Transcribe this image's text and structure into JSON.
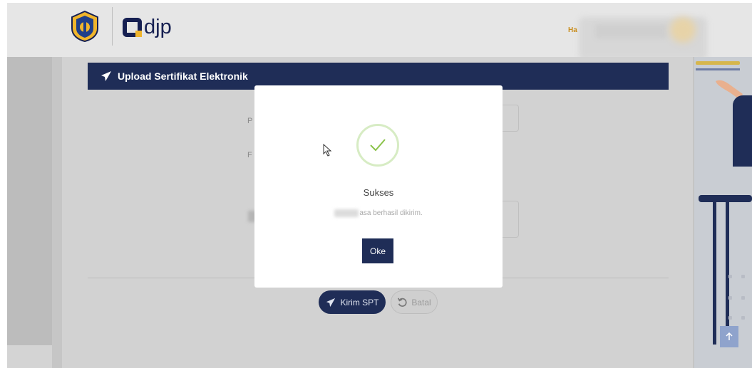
{
  "header": {
    "brand_text": "djp",
    "user_prefix": "Ha"
  },
  "page": {
    "card_title": "Upload Sertifikat Elektronik",
    "field_labels": [
      "P",
      "F"
    ],
    "submit_label": "Kirim SPT",
    "cancel_label": "Batal"
  },
  "modal": {
    "title": "Sukses",
    "message": "asa berhasil dikirim.",
    "ok_label": "Oke"
  },
  "colors": {
    "navy": "#1f2d57",
    "success_green": "#8bc34a",
    "accent_gold": "#f0b52c"
  },
  "icons": [
    "kemenkeu-emblem",
    "paper-plane-icon",
    "undo-icon",
    "check-icon",
    "arrow-up-icon",
    "mouse-cursor-icon"
  ]
}
